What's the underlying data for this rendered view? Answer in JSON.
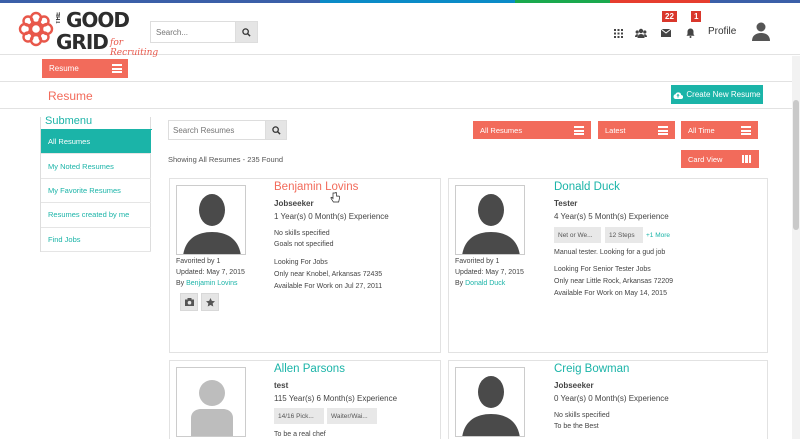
{
  "colors": {
    "accent": "#f26b5b",
    "teal": "#1bb4a8",
    "badge": "#d9372c",
    "stripe": [
      "#3b5fa8",
      "#0a8bc7",
      "#1aa94e",
      "#e63d2f",
      "#3b5fa8"
    ]
  },
  "logo": {
    "the": "THE",
    "good": "GOOD",
    "grid": "GRID",
    "tagline": "for Recruiting"
  },
  "header": {
    "search_placeholder": "Search...",
    "icons": [
      "apps-grid-icon",
      "users-icon",
      "envelope-icon",
      "bell-icon"
    ],
    "messages_count": "22",
    "notifications_count": "1",
    "profile_label": "Profile"
  },
  "subbar": {
    "resume_label": "Resume"
  },
  "page": {
    "title": "Resume",
    "create_label": "Create New Resume"
  },
  "submenu": {
    "title": "Submenu",
    "items": [
      {
        "label": "All Resumes"
      },
      {
        "label": "My Noted Resumes"
      },
      {
        "label": "My Favorite Resumes"
      },
      {
        "label": "Resumes created by me"
      },
      {
        "label": "Find Jobs"
      }
    ]
  },
  "filters": {
    "search_placeholder": "Search Resumes",
    "type": "All Resumes",
    "sort": "Latest",
    "time": "All Time",
    "view": "Card View",
    "showing_text": "Showing All Resumes - 235 Found"
  },
  "cards": [
    {
      "name": "Benjamin Lovins",
      "role": "Jobseeker",
      "experience": "1 Year(s) 0 Month(s) Experience",
      "skills": "No skills specified",
      "goals": "Goals not specified",
      "looking_for": "Looking For Jobs",
      "only_near": "Only near Knobel, Arkansas 72435",
      "available": "Available For Work on Jul 27, 2011",
      "favorited": "Favorited by 1",
      "updated": "Updated: May 7, 2015",
      "by_label": "By",
      "by_name": "Benjamin Lovins"
    },
    {
      "name": "Donald Duck",
      "role": "Tester",
      "experience": "4 Year(s) 5 Month(s) Experience",
      "chips": [
        "Net or We...",
        "12 Steps"
      ],
      "more": "+1 More",
      "goals": "Manual tester. Looking for a gud job",
      "looking_for": "Looking For Senior Tester Jobs",
      "only_near": "Only near Little Rock, Arkansas 72209",
      "available": "Available For Work on May 14, 2015",
      "favorited": "Favorited by 1",
      "updated": "Updated: May 7, 2015",
      "by_label": "By",
      "by_name": "Donald Duck"
    },
    {
      "name": "Allen Parsons",
      "role": "test",
      "experience": "115 Year(s) 6 Month(s) Experience",
      "chips": [
        "14/16 Pick...",
        "Waiter/Wai..."
      ],
      "goals": "To be a real chef"
    },
    {
      "name": "Creig Bowman",
      "role": "Jobseeker",
      "experience": "0 Year(s) 0 Month(s) Experience",
      "skills": "No skills specified",
      "goals": "To be the Best"
    }
  ]
}
